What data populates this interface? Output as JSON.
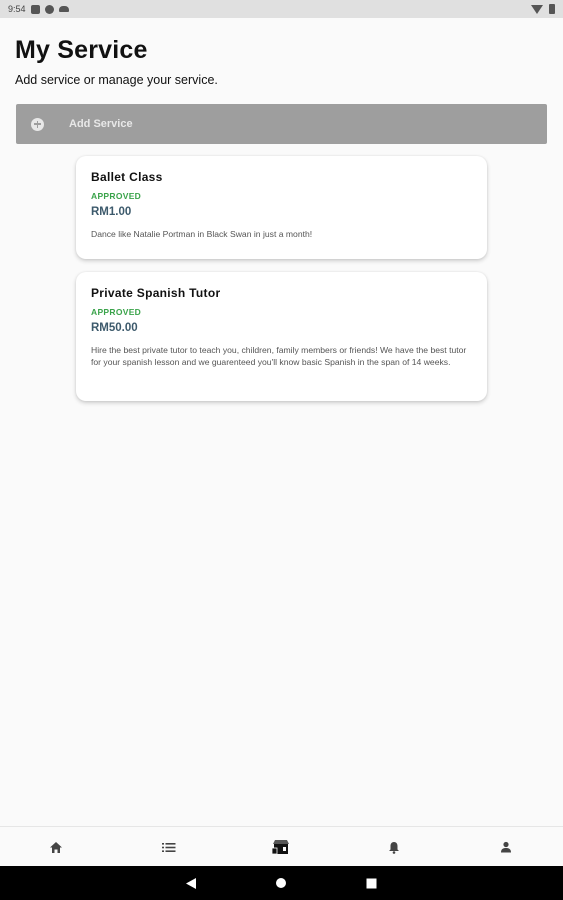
{
  "status_bar": {
    "time": "9:54",
    "icons": [
      "sim-card-icon",
      "circle-app-icon",
      "cloud-icon",
      "wifi-icon",
      "battery-icon"
    ]
  },
  "header": {
    "title": "My Service",
    "subtitle": "Add service or manage your service."
  },
  "add_service": {
    "label": "Add Service",
    "icon": "plus-circle-icon"
  },
  "services": [
    {
      "title": "Ballet Class",
      "status": "APPROVED",
      "price": "RM1.00",
      "description": "Dance like Natalie Portman in Black Swan in just a month!"
    },
    {
      "title": "Private Spanish Tutor",
      "status": "APPROVED",
      "price": "RM50.00",
      "description": "Hire the best private tutor to teach you, children, family members or friends! We have the best tutor for your spanish lesson and we guarenteed you'll know basic Spanish in the span of 14 weeks."
    }
  ],
  "bottom_nav": {
    "items": [
      "home-icon",
      "list-icon",
      "store-icon",
      "bell-icon",
      "profile-icon"
    ],
    "active": "store-icon"
  },
  "colors": {
    "approved": "#3aa34a",
    "price": "#3d5a6c",
    "add_button_bg": "#9e9e9e"
  }
}
